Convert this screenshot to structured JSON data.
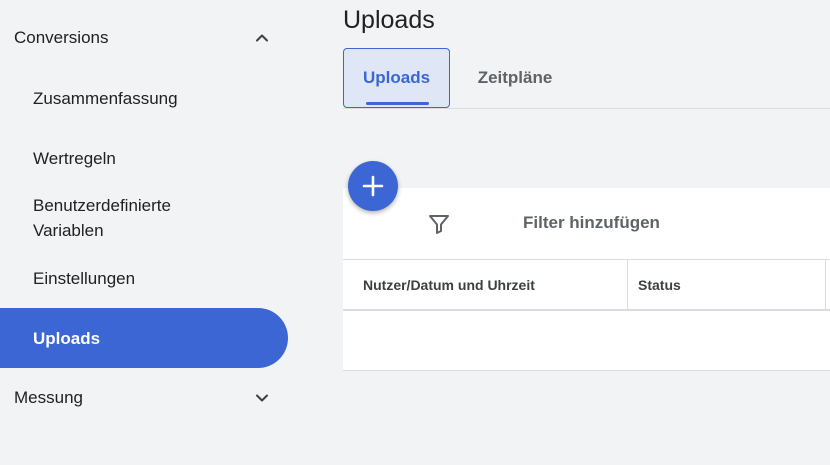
{
  "sidebar": {
    "conversions_section": {
      "label": "Conversions",
      "expanded": true
    },
    "items": [
      {
        "label": "Zusammenfassung"
      },
      {
        "label": "Wertregeln"
      },
      {
        "label": "Benutzerdefinierte Variablen"
      },
      {
        "label": "Einstellungen"
      },
      {
        "label": "Uploads",
        "active": true
      }
    ],
    "measurement_section": {
      "label": "Messung",
      "expanded": false
    }
  },
  "main": {
    "title": "Uploads",
    "tabs": [
      {
        "label": "Uploads",
        "active": true
      },
      {
        "label": "Zeitpläne",
        "active": false
      }
    ],
    "filter": {
      "label": "Filter hinzufügen",
      "icon": "filter-icon"
    },
    "table": {
      "columns": [
        "Nutzer/Datum und Uhrzeit",
        "Status"
      ],
      "rows": []
    },
    "fab": {
      "icon": "plus-icon"
    }
  },
  "colors": {
    "accent": "#3b66d4",
    "background": "#f1f3f4",
    "tab_active_bg": "#dfe6f5"
  }
}
